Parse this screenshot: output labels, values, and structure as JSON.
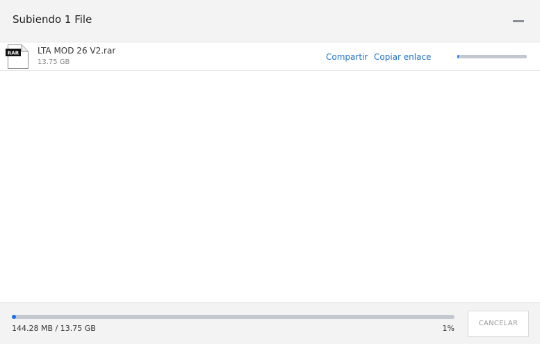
{
  "header": {
    "title": "Subiendo 1 File",
    "minimize_icon": "minimize-icon"
  },
  "file": {
    "icon": "rar-file-icon",
    "icon_label": "RAR",
    "name": "LTA MOD 26 V2.rar",
    "size": "13.75 GB",
    "share_label": "Compartir",
    "copy_link_label": "Copiar enlace",
    "progress": 0.01
  },
  "footer": {
    "progress": 0.01,
    "transferred": "144.28 MB / 13.75 GB",
    "percent": "1%",
    "cancel_label": "CANCELAR"
  },
  "colors": {
    "accent": "#1a73e8",
    "link": "#1e73c9",
    "track": "#c2c7d0",
    "panel": "#f3f3f3"
  }
}
